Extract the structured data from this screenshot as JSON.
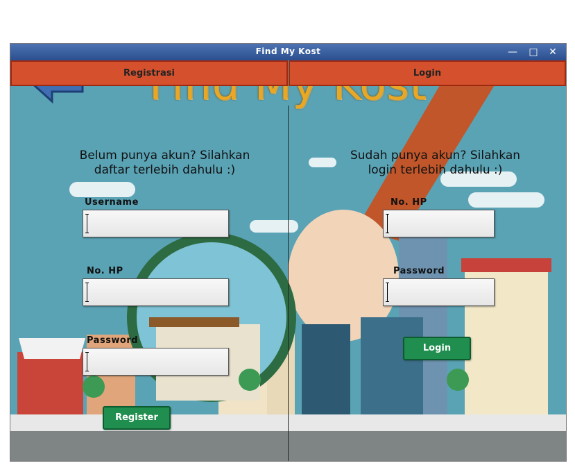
{
  "window": {
    "title": "Find My Kost"
  },
  "header": {
    "logo_text": "Find My Kost",
    "back_icon": "back-arrow-icon"
  },
  "tabs": {
    "register": "Registrasi",
    "login": "Login"
  },
  "register": {
    "prompt_line1": "Belum punya akun? Silahkan",
    "prompt_line2": "daftar terlebih dahulu :)",
    "username_label": "Username",
    "username_value": "",
    "phone_label": "No. HP",
    "phone_value": "",
    "password_label": "Password",
    "password_value": "",
    "button_label": "Register"
  },
  "login": {
    "prompt_line1": "Sudah punya akun? Silahkan",
    "prompt_line2": "login terlebih dahulu :)",
    "phone_label": "No. HP",
    "phone_value": "",
    "password_label": "Password",
    "password_value": "",
    "button_label": "Login"
  },
  "colors": {
    "accent": "#d5512e",
    "button": "#1f8e4e",
    "sky": "#5aa3b5",
    "logo": "#e8a826"
  }
}
